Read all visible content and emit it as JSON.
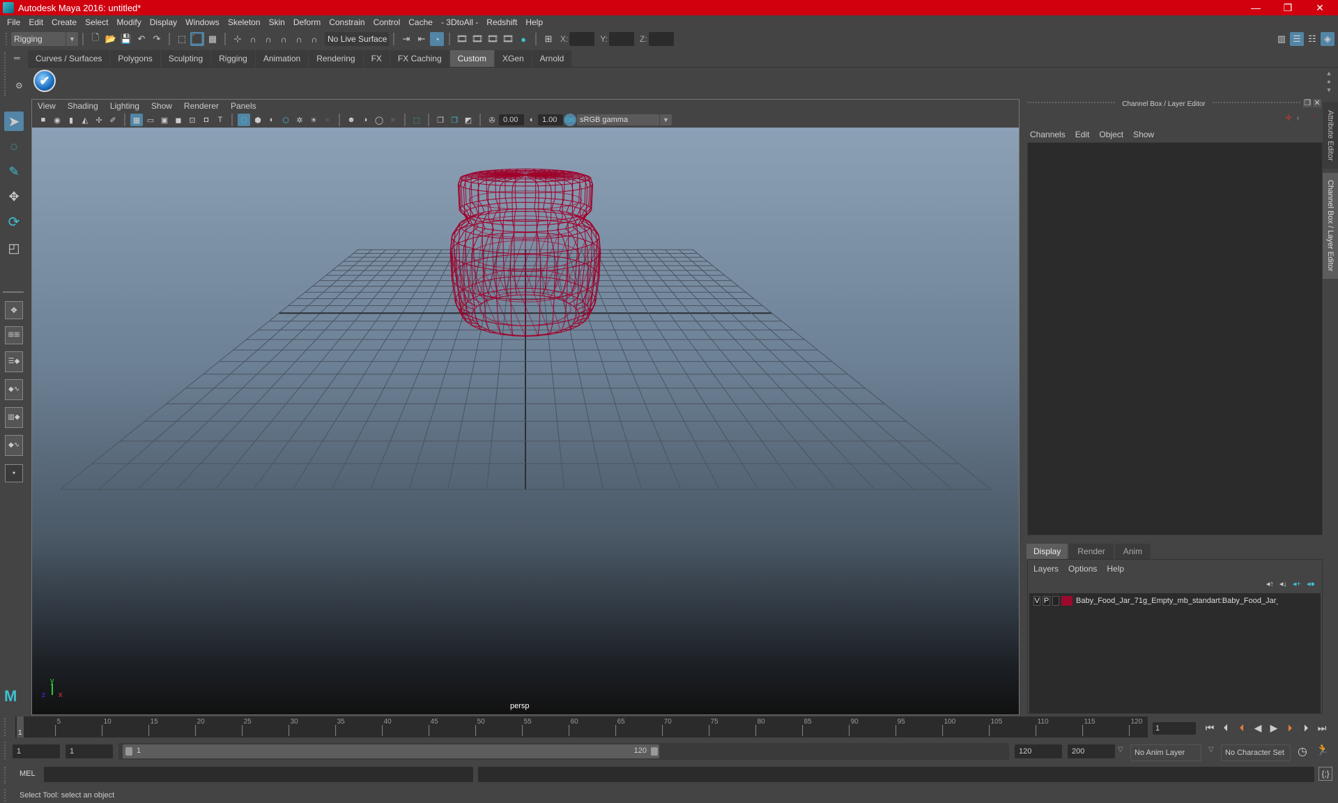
{
  "window": {
    "title": "Autodesk Maya 2016: untitled*",
    "controls": {
      "minimize": "—",
      "restore": "❐",
      "close": "✕"
    }
  },
  "menubar": [
    "File",
    "Edit",
    "Create",
    "Select",
    "Modify",
    "Display",
    "Windows",
    "Skeleton",
    "Skin",
    "Deform",
    "Constrain",
    "Control",
    "Cache",
    "- 3DtoAll -",
    "Redshift",
    "Help"
  ],
  "toolbar": {
    "menuset": "Rigging",
    "live_surface": "No Live Surface",
    "coord_labels": {
      "x": "X:",
      "y": "Y:",
      "z": "Z:"
    },
    "coord_values": {
      "x": "",
      "y": "",
      "z": ""
    }
  },
  "shelf": {
    "tabs": [
      "Curves / Surfaces",
      "Polygons",
      "Sculpting",
      "Rigging",
      "Animation",
      "Rendering",
      "FX",
      "FX Caching",
      "Custom",
      "XGen",
      "Arnold"
    ],
    "active_tab": "Custom"
  },
  "viewport": {
    "menu": [
      "View",
      "Shading",
      "Lighting",
      "Show",
      "Renderer",
      "Panels"
    ],
    "exposure": "0.00",
    "gamma": "1.00",
    "color_space": "sRGB gamma",
    "camera_label": "persp",
    "axis": {
      "x": "x",
      "y": "y",
      "z": "z"
    },
    "wire_color": "#a0002a"
  },
  "channel_box": {
    "title": "Channel Box / Layer Editor",
    "menu": [
      "Channels",
      "Edit",
      "Object",
      "Show"
    ]
  },
  "layer_editor": {
    "tabs": [
      "Display",
      "Render",
      "Anim"
    ],
    "active_tab": "Display",
    "menu": [
      "Layers",
      "Options",
      "Help"
    ],
    "layers": [
      {
        "visible": "V",
        "playback": "P",
        "color": "#9b0a2e",
        "name": "Baby_Food_Jar_71g_Empty_mb_standart:Baby_Food_Jar_"
      }
    ]
  },
  "side_tabs": [
    "Attribute Editor",
    "Channel Box / Layer Editor"
  ],
  "timeline": {
    "ticks": [
      "5",
      "10",
      "15",
      "20",
      "25",
      "30",
      "35",
      "40",
      "45",
      "50",
      "55",
      "60",
      "65",
      "70",
      "75",
      "80",
      "85",
      "90",
      "95",
      "100",
      "105",
      "110",
      "115",
      "120"
    ],
    "current_frame_marker": "1",
    "current_frame": "1"
  },
  "range": {
    "start": "1",
    "playback_start": "1",
    "slider_start_label": "1",
    "slider_end_label": "120",
    "playback_end": "120",
    "end": "200",
    "anim_layer": "No Anim Layer",
    "character_set": "No Character Set"
  },
  "command_line": {
    "language": "MEL",
    "input": "",
    "result": ""
  },
  "help_line": "Select Tool: select an object"
}
